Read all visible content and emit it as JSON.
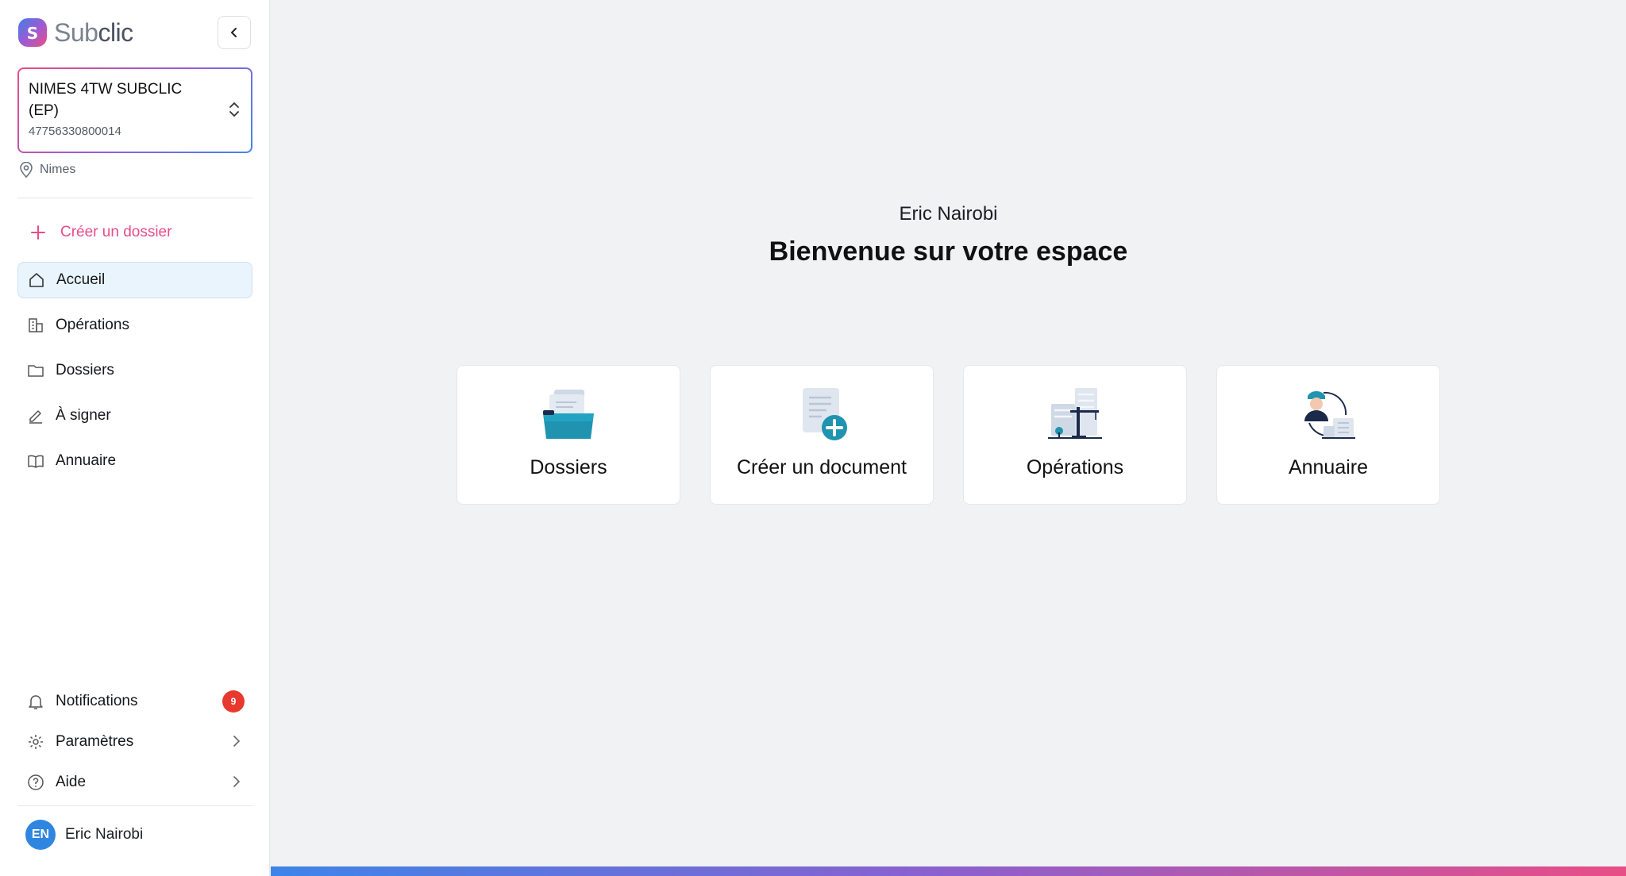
{
  "app": {
    "logo_prefix": "Sub",
    "logo_suffix": "clic"
  },
  "organization": {
    "name": "NIMES 4TW SUBCLIC (EP)",
    "siret": "47756330800014",
    "location": "Nimes"
  },
  "sidebar": {
    "create_label": "Créer un dossier",
    "items": [
      {
        "label": "Accueil",
        "icon": "home-icon",
        "active": true
      },
      {
        "label": "Opérations",
        "icon": "building-icon"
      },
      {
        "label": "Dossiers",
        "icon": "folder-icon"
      },
      {
        "label": "À signer",
        "icon": "pen-icon"
      },
      {
        "label": "Annuaire",
        "icon": "book-icon"
      }
    ],
    "bottom": {
      "notifications": {
        "label": "Notifications",
        "count": "9"
      },
      "settings": {
        "label": "Paramètres"
      },
      "help": {
        "label": "Aide"
      }
    },
    "user": {
      "initials": "EN",
      "name": "Eric Nairobi"
    }
  },
  "main": {
    "greeting": "Eric Nairobi",
    "title": "Bienvenue sur votre espace",
    "cards": [
      {
        "label": "Dossiers",
        "icon": "folder-illustration"
      },
      {
        "label": "Créer un document",
        "icon": "document-add-illustration"
      },
      {
        "label": "Opérations",
        "icon": "construction-illustration"
      },
      {
        "label": "Annuaire",
        "icon": "contacts-illustration"
      }
    ]
  },
  "colors": {
    "accent_pink": "#e84c86",
    "accent_blue": "#3e84e8",
    "active_bg": "#e9f4fc",
    "badge_red": "#e8392f"
  }
}
